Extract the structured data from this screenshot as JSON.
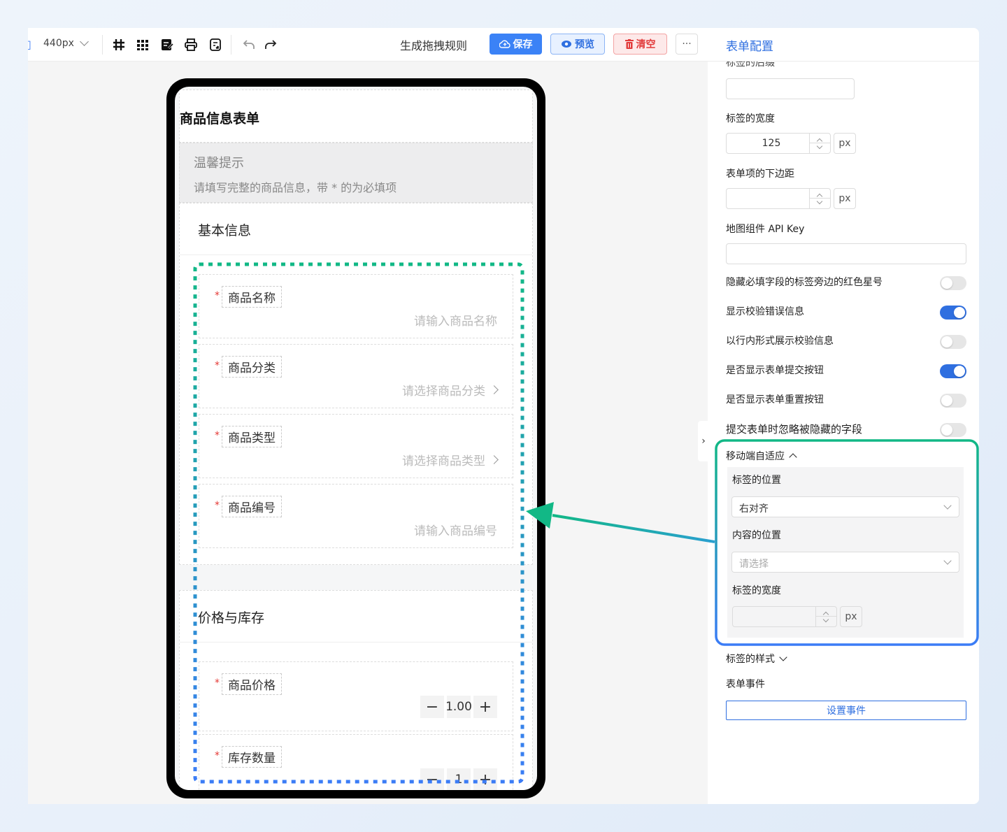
{
  "toolbar": {
    "width_value": "440px",
    "generate_rules": "生成拖拽规则",
    "save": "保存",
    "preview": "预览",
    "clear": "清空",
    "more": "···"
  },
  "form": {
    "title": "商品信息表单",
    "tip_title": "温馨提示",
    "tip_text": "请填写完整的商品信息，带 * 的为必填项",
    "section_basic": "基本信息",
    "section_price": "价格与库存",
    "fields": [
      {
        "label": "商品名称",
        "placeholder": "请输入商品名称"
      },
      {
        "label": "商品分类",
        "placeholder": "请选择商品分类"
      },
      {
        "label": "商品类型",
        "placeholder": "请选择商品类型"
      },
      {
        "label": "商品编号",
        "placeholder": "请输入商品编号"
      }
    ],
    "price_label": "商品价格",
    "price_value": "1.00",
    "stock_label": "库存数量",
    "stock_value": "1",
    "required_mark": "*"
  },
  "panel": {
    "title": "表单配置",
    "cut_label": "标签的后缀",
    "label_width": "标签的宽度",
    "label_width_value": "125",
    "unit": "px",
    "item_margin": "表单项的下边距",
    "map_key": "地图组件 API Key",
    "toggles": [
      {
        "label": "隐藏必填字段的标签旁边的红色星号",
        "on": false
      },
      {
        "label": "显示校验错误信息",
        "on": true
      },
      {
        "label": "以行内形式展示校验信息",
        "on": false
      },
      {
        "label": "是否显示表单提交按钮",
        "on": true
      },
      {
        "label": "是否显示表单重置按钮",
        "on": false
      },
      {
        "label": "提交表单时忽略被隐藏的字段",
        "on": false
      }
    ],
    "mobile_title": "移动端自适应",
    "m_label_pos": "标签的位置",
    "m_label_pos_value": "右对齐",
    "m_content_pos": "内容的位置",
    "m_content_pos_placeholder": "请选择",
    "m_label_width": "标签的宽度",
    "label_style": "标签的样式",
    "form_events": "表单事件",
    "set_events": "设置事件",
    "collapse": "›"
  },
  "colors": {
    "primary": "#2f6fe0",
    "danger": "#e23b3b",
    "green": "#12b886",
    "blue": "#3b7cf6"
  }
}
